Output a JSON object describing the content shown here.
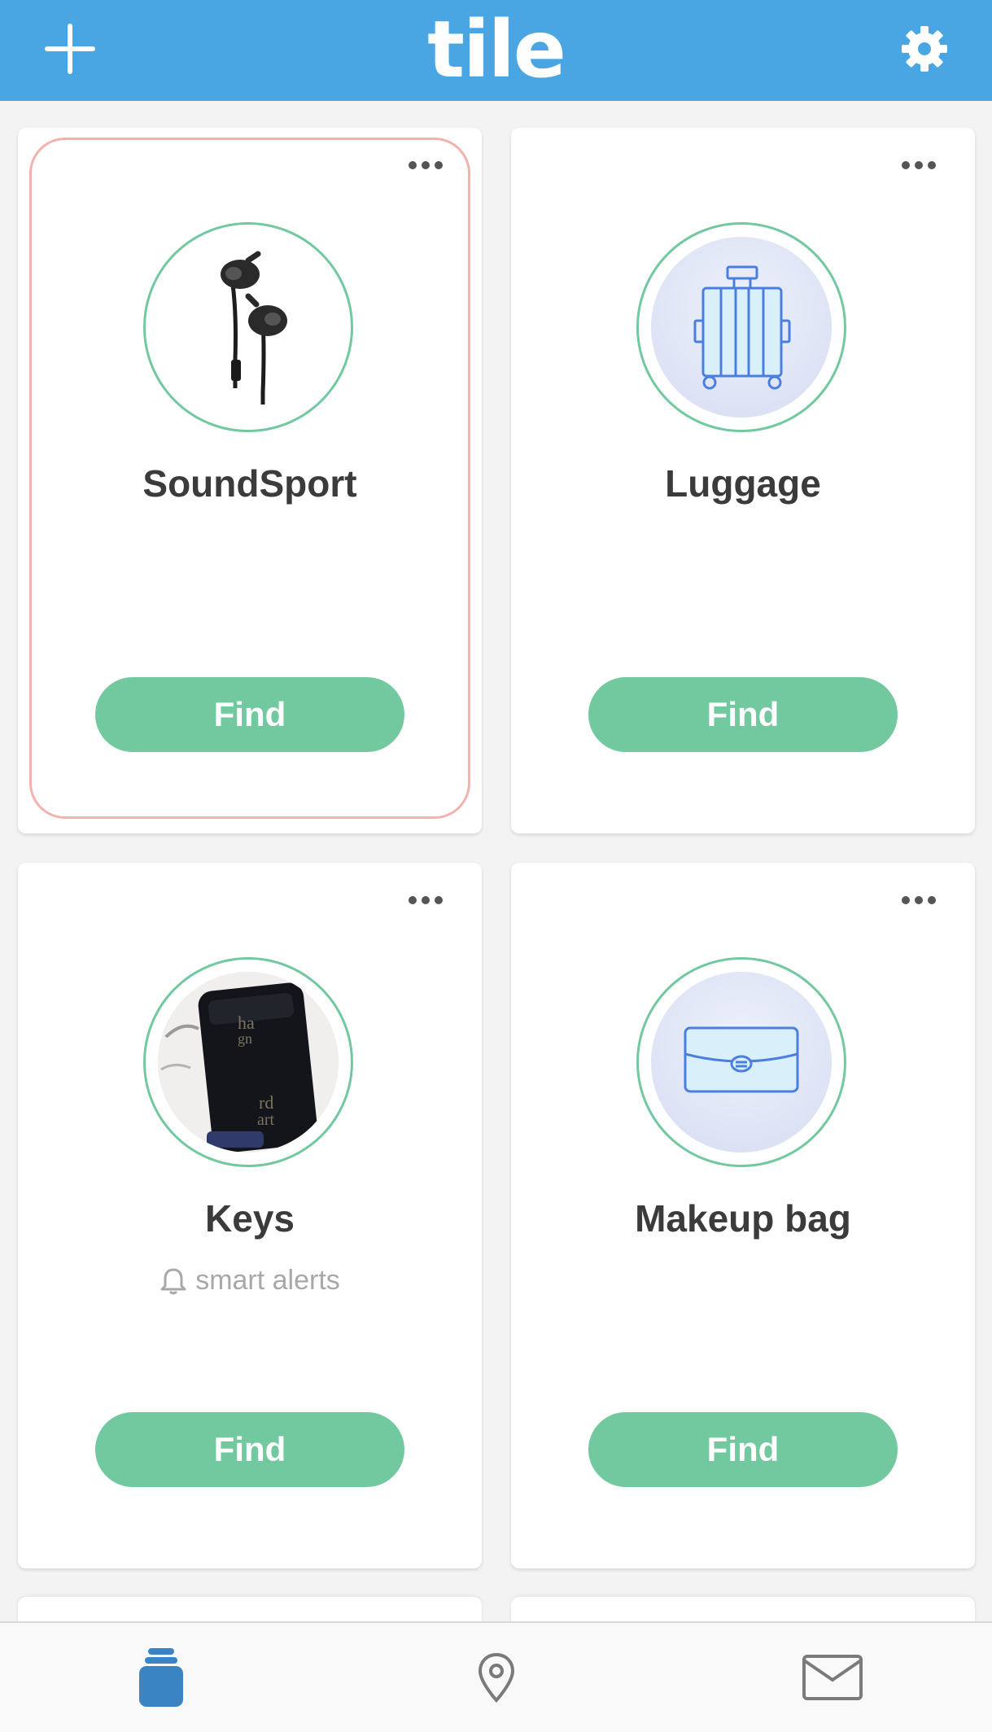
{
  "header": {
    "logo_text": "tile",
    "add_icon": "plus-icon",
    "settings_icon": "gear-icon",
    "background": "#4aa6e2"
  },
  "items": [
    {
      "name": "SoundSport",
      "subtitle": "",
      "find_label": "Find",
      "image": "earbuds-photo",
      "selected": true
    },
    {
      "name": "Luggage",
      "subtitle": "",
      "find_label": "Find",
      "image": "suitcase-icon",
      "selected": false
    },
    {
      "name": "Keys",
      "subtitle": "smart alerts",
      "find_label": "Find",
      "image": "keys-pouch-photo",
      "selected": false
    },
    {
      "name": "Makeup bag",
      "subtitle": "",
      "find_label": "Find",
      "image": "makeup-bag-icon",
      "selected": false
    }
  ],
  "tabbar": {
    "tabs": [
      {
        "name": "my-tiles",
        "icon": "tile-jar-icon",
        "active": true
      },
      {
        "name": "map",
        "icon": "location-pin-icon",
        "active": false
      },
      {
        "name": "messages",
        "icon": "envelope-icon",
        "active": false
      }
    ],
    "active_color": "#3b84c4"
  },
  "colors": {
    "accent_green": "#72c9a0",
    "selected_outline": "#f2b3ae"
  }
}
